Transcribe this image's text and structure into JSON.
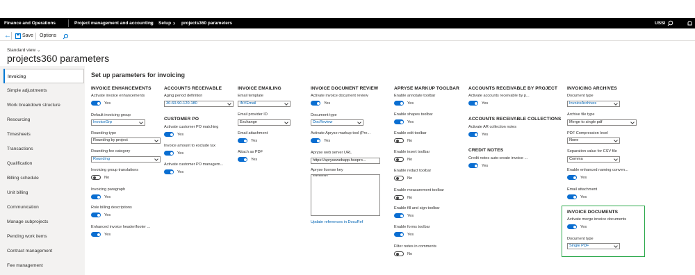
{
  "topbar": {
    "app": "Finance and Operations",
    "bc1": "Project management and accounting",
    "bc2": "Setup",
    "bc3": "projects360 parameters",
    "company": "USSI"
  },
  "cmd": {
    "save": "Save",
    "options": "Options"
  },
  "view": {
    "std": "Standard view",
    "title": "projects360 parameters"
  },
  "sidebar": [
    "Invoicing",
    "Simple adjustments",
    "Work breakdown structure",
    "Resourcing",
    "Timesheets",
    "Transactions",
    "Qualification",
    "Billing schedule",
    "Unit billing",
    "Communication",
    "Manage subprojects",
    "Pending work items",
    "Contract management",
    "Fee management"
  ],
  "section_title": "Set up parameters for invoicing",
  "c1": {
    "h": "INVOICE ENHANCEMENTS",
    "l1": "Activate invoice enhancements",
    "t1": "Yes",
    "l2": "Default invoicing group",
    "v2": "InvoiceGrp",
    "l3": "Rounding type",
    "v3": "Rounding by project",
    "l4": "Rounding fee category",
    "v4": "Rounding",
    "l5": "Invoicing group translations",
    "t5": "No",
    "l6": "Invoicing paragraph",
    "t6": "Yes",
    "l7": "Role billing descriptions",
    "t7": "Yes",
    "l8": "Enhanced invoice header/footer ...",
    "t8": "Yes"
  },
  "c2": {
    "h": "ACCOUNTS RECEIVABLE",
    "l1": "Aging period definition",
    "v1": "30-60-90-120-180",
    "h2": "CUSTOMER PO",
    "l2": "Activate customer PO matching",
    "t2": "Yes",
    "l3": "Invoice amount to exclude tax",
    "t3": "Yes",
    "l4": "Activate customer PO managem...",
    "t4": "Yes"
  },
  "c3": {
    "h": "INVOICE EMAILING",
    "l1": "Email template",
    "v1": "INVEmail",
    "l2": "Email provider ID",
    "v2": "Exchange",
    "l3": "Email attachment",
    "t3": "Yes",
    "l4": "Attach as PDF",
    "t4": "Yes"
  },
  "c4": {
    "h": "INVOICE DOCUMENT REVIEW",
    "l1": "Activate invoice document review",
    "t1": "Yes",
    "l2": "Document type",
    "v2": "DocReview",
    "l3": "Activate Apryse markup tool (Pre...",
    "t3": "Yes",
    "l4": "Apryse web server URL",
    "v4": "https://aprysewebapp.hsopro...",
    "l5": "Apryse license key",
    "v5": "**********",
    "link": "Update references in DocuRef"
  },
  "c5": {
    "h": "APRYSE MARKUP TOOLBAR",
    "l1": "Enable annotate toolbar",
    "t1": "Yes",
    "l2": "Enable shapes toolbar",
    "t2": "Yes",
    "l3": "Enable edit toolbar",
    "t3": "No",
    "l4": "Enable insert toolbar",
    "t4": "No",
    "l5": "Enable redact toolbar",
    "t5": "No",
    "l6": "Enable measurement toolbar",
    "t6": "No",
    "l7": "Enable fill and sign toolbar",
    "t7": "Yes",
    "l8": "Enable forms toolbar",
    "t8": "Yes",
    "l9": "Filter notes in comments",
    "t9": "No"
  },
  "c6": {
    "h": "ACCOUNTS RECEIVABLE BY PROJECT",
    "l1": "Activate accounts receivable by p...",
    "t1": "Yes",
    "h2": "ACCOUNTS RECEIVABLE COLLECTIONS",
    "l2": "Activate AR collection notes",
    "t2": "Yes",
    "h3": "CREDIT NOTES",
    "l3": "Credit notes auto-create invoice ...",
    "t3": "Yes"
  },
  "c7": {
    "h": "INVOICING ARCHIVES",
    "l1": "Document type",
    "v1": "InvoiceArchives",
    "l2": "Archive file type",
    "v2": "Merge to single pdf",
    "l3": "PDF Compression level",
    "v3": "None",
    "l4": "Separation value for CSV file",
    "v4": "Comma",
    "l5": "Enable enhanced naming conven...",
    "t5": "Yes",
    "l6": "Email attachment",
    "t6": "Yes",
    "h2": "INVOICE DOCUMENTS",
    "l7": "Activate merge invoice documents",
    "t7": "Yes",
    "l8": "Document type",
    "v8": "Single PDF"
  },
  "colors": {
    "accent": "#0a6ed1",
    "highlight": "#2aa84a",
    "topbar": "#000000"
  }
}
